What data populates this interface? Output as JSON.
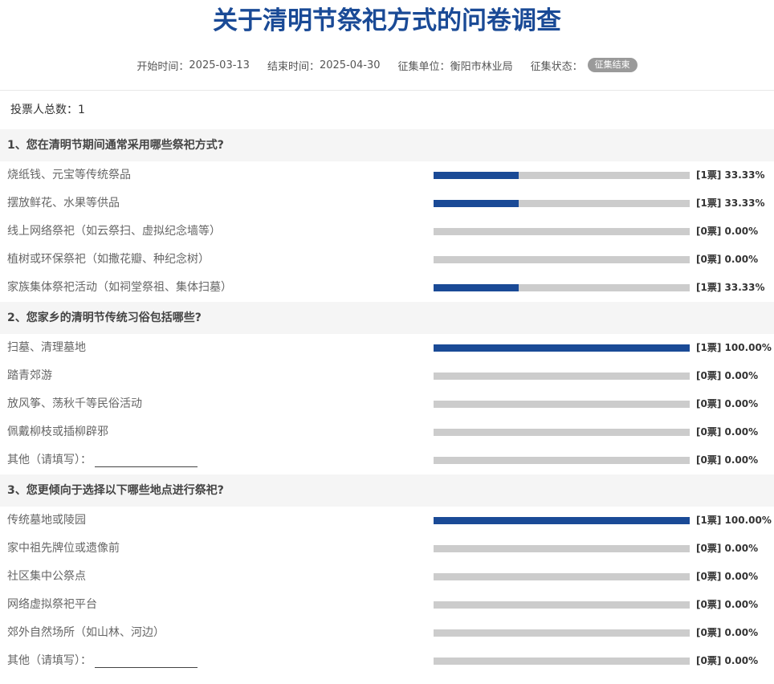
{
  "survey": {
    "title": "关于清明节祭祀方式的问卷调查",
    "start_label": "开始时间：",
    "start_value": "2025-03-13",
    "end_label": "结束时间：",
    "end_value": "2025-04-30",
    "org_label": "征集单位：",
    "org_value": "衡阳市林业局",
    "status_label": "征集状态：",
    "status_value": "征集结束"
  },
  "total_label": "投票人总数：1",
  "questions": [
    {
      "title": "1、您在清明节期间通常采用哪些祭祀方式?",
      "options": [
        {
          "label": "烧纸钱、元宝等传统祭品",
          "votes": "[1票]",
          "percent": "33.33%",
          "ratio": 0.3333
        },
        {
          "label": "摆放鲜花、水果等供品",
          "votes": "[1票]",
          "percent": "33.33%",
          "ratio": 0.3333
        },
        {
          "label": "线上网络祭祀（如云祭扫、虚拟纪念墙等）",
          "votes": "[0票]",
          "percent": "0.00%",
          "ratio": 0
        },
        {
          "label": "植树或环保祭祀（如撒花瓣、种纪念树）",
          "votes": "[0票]",
          "percent": "0.00%",
          "ratio": 0
        },
        {
          "label": "家族集体祭祀活动（如祠堂祭祖、集体扫墓）",
          "votes": "[1票]",
          "percent": "33.33%",
          "ratio": 0.3333
        }
      ]
    },
    {
      "title": "2、您家乡的清明节传统习俗包括哪些?",
      "options": [
        {
          "label": "扫墓、清理墓地",
          "votes": "[1票]",
          "percent": "100.00%",
          "ratio": 1
        },
        {
          "label": "踏青郊游",
          "votes": "[0票]",
          "percent": "0.00%",
          "ratio": 0
        },
        {
          "label": "放风筝、荡秋千等民俗活动",
          "votes": "[0票]",
          "percent": "0.00%",
          "ratio": 0
        },
        {
          "label": "佩戴柳枝或插柳辟邪",
          "votes": "[0票]",
          "percent": "0.00%",
          "ratio": 0
        },
        {
          "label": "其他（请填写）：",
          "votes": "[0票]",
          "percent": "0.00%",
          "ratio": 0,
          "fill": true
        }
      ]
    },
    {
      "title": "3、您更倾向于选择以下哪些地点进行祭祀?",
      "options": [
        {
          "label": "传统墓地或陵园",
          "votes": "[1票]",
          "percent": "100.00%",
          "ratio": 1
        },
        {
          "label": "家中祖先牌位或遗像前",
          "votes": "[0票]",
          "percent": "0.00%",
          "ratio": 0
        },
        {
          "label": "社区集中公祭点",
          "votes": "[0票]",
          "percent": "0.00%",
          "ratio": 0
        },
        {
          "label": "网络虚拟祭祀平台",
          "votes": "[0票]",
          "percent": "0.00%",
          "ratio": 0
        },
        {
          "label": "郊外自然场所（如山林、河边）",
          "votes": "[0票]",
          "percent": "0.00%",
          "ratio": 0
        },
        {
          "label": "其他（请填写）：",
          "votes": "[0票]",
          "percent": "0.00%",
          "ratio": 0,
          "fill": true
        }
      ]
    }
  ],
  "colors": {
    "accent": "#1a4a96",
    "bar_track": "#cccccc",
    "badge": "#9a9a9a"
  }
}
